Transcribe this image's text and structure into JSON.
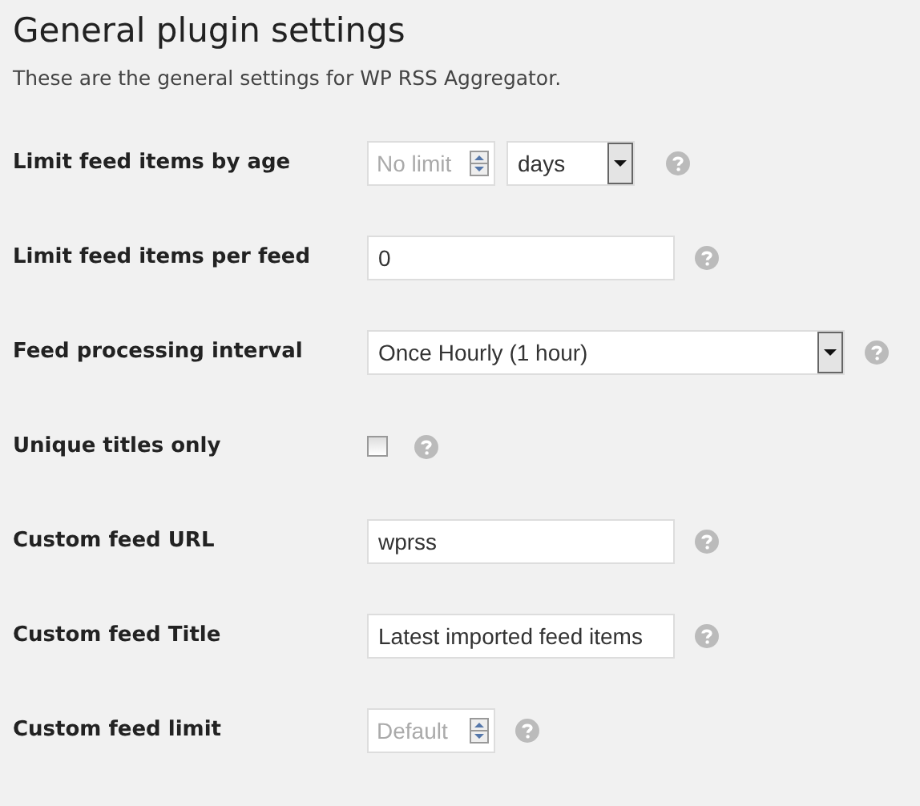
{
  "title": "General plugin settings",
  "description": "These are the general settings for WP RSS Aggregator.",
  "rows": [
    {
      "label": "Limit feed items by age",
      "kind": "number-unit",
      "placeholder": "No limit",
      "unit": "days"
    },
    {
      "label": "Limit feed items per feed",
      "kind": "text",
      "value": "0"
    },
    {
      "label": "Feed processing interval",
      "kind": "select",
      "value": "Once Hourly (1 hour)"
    },
    {
      "label": "Unique titles only",
      "kind": "checkbox",
      "checked": false
    },
    {
      "label": "Custom feed URL",
      "kind": "text",
      "value": "wprss"
    },
    {
      "label": "Custom feed Title",
      "kind": "text",
      "value": "Latest imported feed items"
    },
    {
      "label": "Custom feed limit",
      "kind": "number",
      "placeholder": "Default"
    }
  ]
}
